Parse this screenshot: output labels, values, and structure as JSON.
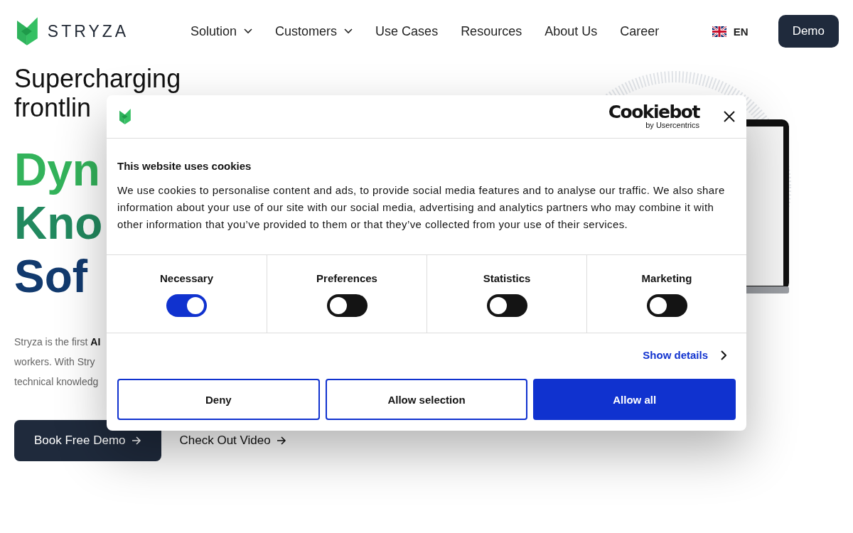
{
  "header": {
    "logo_text": "STRYZA",
    "nav": [
      {
        "label": "Solution",
        "dropdown": true
      },
      {
        "label": "Customers",
        "dropdown": true
      },
      {
        "label": "Use Cases",
        "dropdown": false
      },
      {
        "label": "Resources",
        "dropdown": false
      },
      {
        "label": "About Us",
        "dropdown": false
      },
      {
        "label": "Career",
        "dropdown": false
      }
    ],
    "language": "EN",
    "demo_button": "Demo"
  },
  "hero": {
    "eyebrow": [
      "Supercharging",
      "frontlin"
    ],
    "headline": [
      {
        "text": "Dyn",
        "color": "#33b35b"
      },
      {
        "text": "Kno",
        "color": "#22895f"
      },
      {
        "text": "Sof",
        "color": "#123a6e"
      }
    ],
    "description": [
      "Stryza is the first **AI**",
      "workers. With Stry",
      "technical knowledg"
    ],
    "primary_button": "Book Free Demo",
    "secondary_link": "Check Out Video"
  },
  "cookie_dialog": {
    "brand": "Cookiebot",
    "brand_sub": "by Usercentrics",
    "title": "This website uses cookies",
    "body": "We use cookies to personalise content and ads, to provide social media features and to analyse our traffic. We also share information about your use of our site with our social media, advertising and analytics partners who may combine it with other information that you’ve provided to them or that they’ve collected from your use of their services.",
    "categories": [
      {
        "label": "Necessary",
        "on": true
      },
      {
        "label": "Preferences",
        "on": false
      },
      {
        "label": "Statistics",
        "on": false
      },
      {
        "label": "Marketing",
        "on": false
      }
    ],
    "show_details": "Show details",
    "buttons": [
      {
        "label": "Deny",
        "kind": "outline"
      },
      {
        "label": "Allow selection",
        "kind": "outline"
      },
      {
        "label": "Allow all",
        "kind": "primary"
      }
    ]
  }
}
